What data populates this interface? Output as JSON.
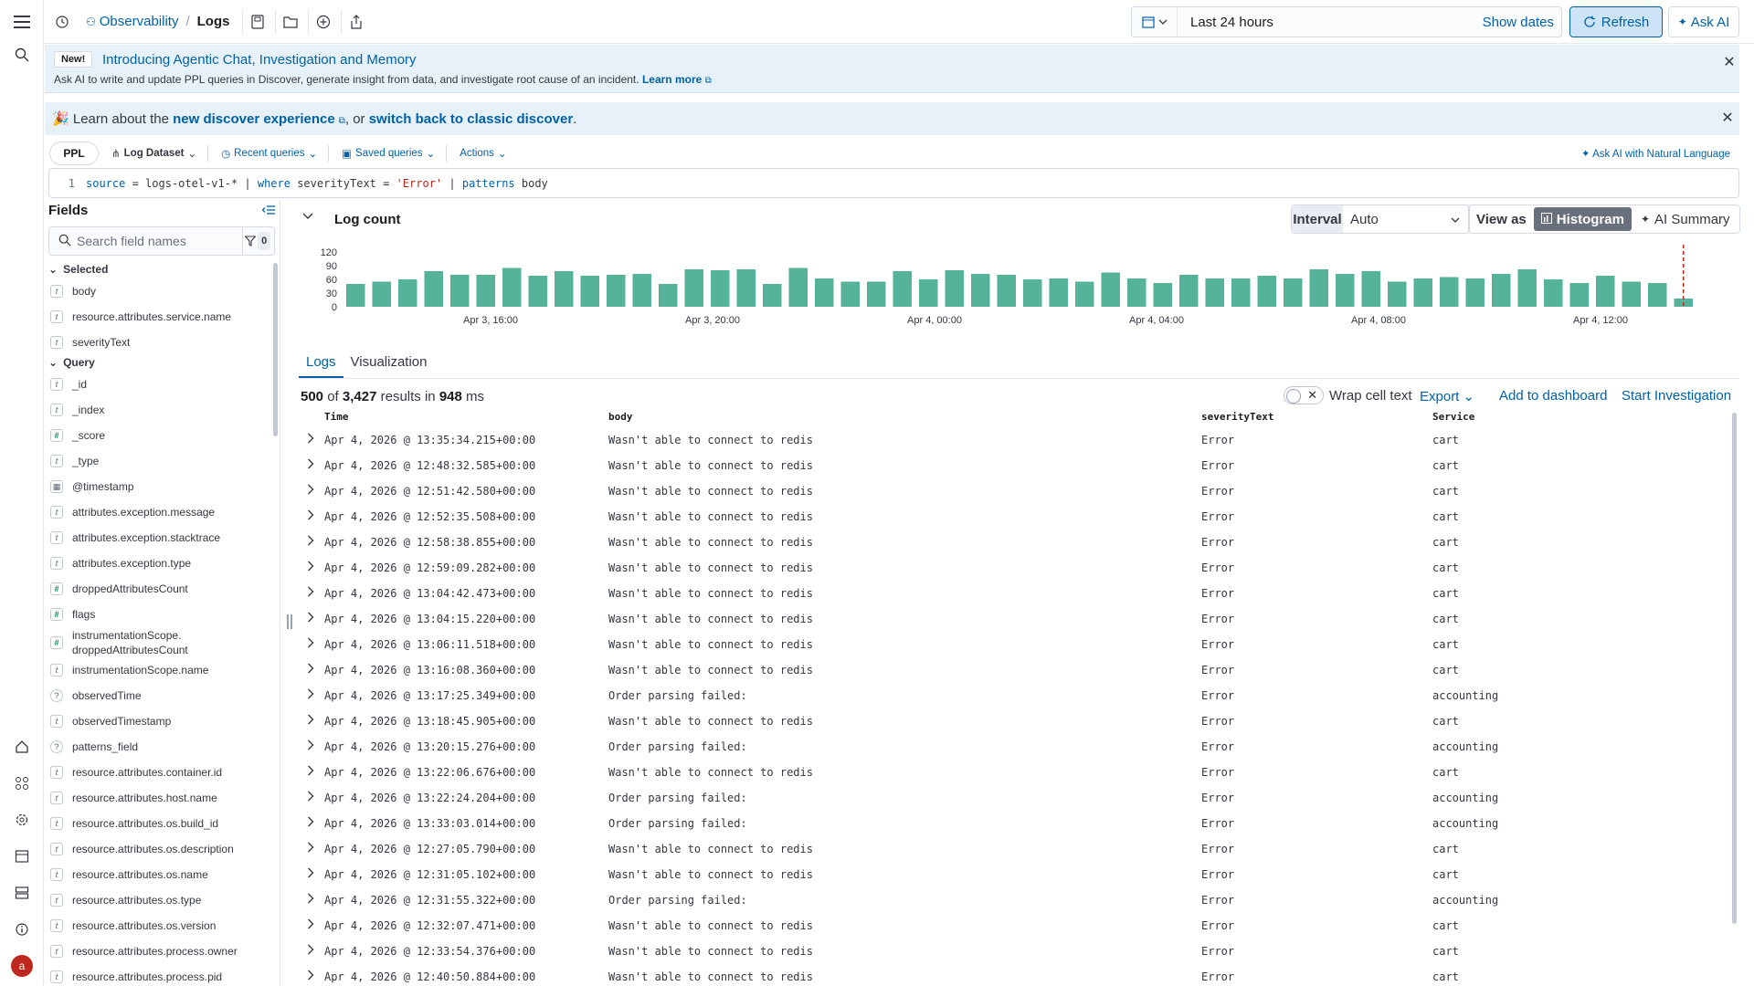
{
  "header": {
    "breadcrumb_root": "Observability",
    "breadcrumb_current": "Logs",
    "date_range": "Last 24 hours",
    "show_dates": "Show dates",
    "refresh": "Refresh",
    "ask_ai": "Ask AI"
  },
  "banner1": {
    "badge": "New!",
    "title": "Introducing Agentic Chat, Investigation and Memory",
    "body": "Ask AI to write and update PPL queries in Discover, generate insight from data, and investigate root cause of an incident.",
    "learn_more": "Learn more"
  },
  "banner2": {
    "emoji": "🎉",
    "prefix": "Learn about the",
    "link1": "new discover experience",
    "middle": ", or",
    "link2": "switch back to classic discover",
    "suffix": "."
  },
  "querybar": {
    "language": "PPL",
    "dataset": "Log Dataset",
    "recent": "Recent queries",
    "saved": "Saved queries",
    "actions": "Actions",
    "ask_ai_nl": "Ask AI with Natural Language",
    "line_no": "1",
    "query": {
      "p1": "source",
      "p2": " = logs-otel-v1-* | ",
      "p3": "where",
      "p4": " severityText = ",
      "p5": "'Error'",
      "p6": " | ",
      "p7": "patterns",
      "p8": " body"
    }
  },
  "fields": {
    "title": "Fields",
    "search_placeholder": "Search field names",
    "filter_count": "0",
    "selected_label": "Selected",
    "query_label": "Query",
    "selected": [
      {
        "type": "t",
        "name": "body"
      },
      {
        "type": "t",
        "name": "resource.attributes.service.name"
      },
      {
        "type": "t",
        "name": "severityText"
      }
    ],
    "query": [
      {
        "type": "t",
        "name": "_id"
      },
      {
        "type": "t",
        "name": "_index"
      },
      {
        "type": "#",
        "name": "_score"
      },
      {
        "type": "t",
        "name": "_type"
      },
      {
        "type": "date",
        "name": "@timestamp"
      },
      {
        "type": "t",
        "name": "attributes.exception.message"
      },
      {
        "type": "t",
        "name": "attributes.exception.stacktrace"
      },
      {
        "type": "t",
        "name": "attributes.exception.type"
      },
      {
        "type": "#",
        "name": "droppedAttributesCount"
      },
      {
        "type": "#",
        "name": "flags"
      },
      {
        "type": "#",
        "name": "instrumentationScope.",
        "name2": "droppedAttributesCount"
      },
      {
        "type": "t",
        "name": "instrumentationScope.name"
      },
      {
        "type": "?",
        "name": "observedTime"
      },
      {
        "type": "t",
        "name": "observedTimestamp"
      },
      {
        "type": "?",
        "name": "patterns_field"
      },
      {
        "type": "t",
        "name": "resource.attributes.container.id"
      },
      {
        "type": "t",
        "name": "resource.attributes.host.name"
      },
      {
        "type": "t",
        "name": "resource.attributes.os.build_id"
      },
      {
        "type": "t",
        "name": "resource.attributes.os.description"
      },
      {
        "type": "t",
        "name": "resource.attributes.os.name"
      },
      {
        "type": "t",
        "name": "resource.attributes.os.type"
      },
      {
        "type": "t",
        "name": "resource.attributes.os.version"
      },
      {
        "type": "t",
        "name": "resource.attributes.process.owner"
      },
      {
        "type": "t",
        "name": "resource.attributes.process.pid"
      }
    ]
  },
  "chart_header": {
    "title": "Log count",
    "interval_label": "Interval",
    "interval_value": "Auto",
    "view_as": "View as",
    "histogram": "Histogram",
    "ai_summary": "AI Summary"
  },
  "chart_data": {
    "type": "bar",
    "color": "#54b399",
    "y_ticks": [
      "120",
      "90",
      "60",
      "30",
      "0"
    ],
    "ylim": [
      0,
      120
    ],
    "x_ticks": [
      "Apr 3, 16:00",
      "Apr 3, 20:00",
      "Apr 4, 00:00",
      "Apr 4, 04:00",
      "Apr 4, 08:00",
      "Apr 4, 12:00"
    ],
    "values": [
      50,
      55,
      60,
      78,
      70,
      70,
      85,
      68,
      78,
      68,
      70,
      72,
      50,
      82,
      80,
      82,
      50,
      85,
      62,
      55,
      55,
      78,
      60,
      80,
      72,
      70,
      60,
      62,
      55,
      75,
      62,
      52,
      70,
      62,
      62,
      68,
      62,
      82,
      72,
      78,
      55,
      62,
      65,
      62,
      72,
      82,
      60,
      52,
      68,
      55,
      52,
      18
    ]
  },
  "tabs": {
    "logs": "Logs",
    "visualization": "Visualization"
  },
  "results": {
    "shown": "500",
    "of": "of",
    "total": "3,427",
    "in": "results in",
    "time": "948",
    "ms": "ms",
    "wrap": "Wrap cell text",
    "export": "Export",
    "add_dashboard": "Add to dashboard",
    "start_investigation": "Start Investigation"
  },
  "table": {
    "columns": [
      "Time",
      "body",
      "severityText",
      "Service"
    ],
    "rows": [
      [
        "Apr 4, 2026 @ 13:35:34.215+00:00",
        "Wasn't able to connect to redis",
        "Error",
        "cart"
      ],
      [
        "Apr 4, 2026 @ 12:48:32.585+00:00",
        "Wasn't able to connect to redis",
        "Error",
        "cart"
      ],
      [
        "Apr 4, 2026 @ 12:51:42.580+00:00",
        "Wasn't able to connect to redis",
        "Error",
        "cart"
      ],
      [
        "Apr 4, 2026 @ 12:52:35.508+00:00",
        "Wasn't able to connect to redis",
        "Error",
        "cart"
      ],
      [
        "Apr 4, 2026 @ 12:58:38.855+00:00",
        "Wasn't able to connect to redis",
        "Error",
        "cart"
      ],
      [
        "Apr 4, 2026 @ 12:59:09.282+00:00",
        "Wasn't able to connect to redis",
        "Error",
        "cart"
      ],
      [
        "Apr 4, 2026 @ 13:04:42.473+00:00",
        "Wasn't able to connect to redis",
        "Error",
        "cart"
      ],
      [
        "Apr 4, 2026 @ 13:04:15.220+00:00",
        "Wasn't able to connect to redis",
        "Error",
        "cart"
      ],
      [
        "Apr 4, 2026 @ 13:06:11.518+00:00",
        "Wasn't able to connect to redis",
        "Error",
        "cart"
      ],
      [
        "Apr 4, 2026 @ 13:16:08.360+00:00",
        "Wasn't able to connect to redis",
        "Error",
        "cart"
      ],
      [
        "Apr 4, 2026 @ 13:17:25.349+00:00",
        "Order parsing failed:",
        "Error",
        "accounting"
      ],
      [
        "Apr 4, 2026 @ 13:18:45.905+00:00",
        "Wasn't able to connect to redis",
        "Error",
        "cart"
      ],
      [
        "Apr 4, 2026 @ 13:20:15.276+00:00",
        "Order parsing failed:",
        "Error",
        "accounting"
      ],
      [
        "Apr 4, 2026 @ 13:22:06.676+00:00",
        "Wasn't able to connect to redis",
        "Error",
        "cart"
      ],
      [
        "Apr 4, 2026 @ 13:22:24.204+00:00",
        "Order parsing failed:",
        "Error",
        "accounting"
      ],
      [
        "Apr 4, 2026 @ 13:33:03.014+00:00",
        "Order parsing failed:",
        "Error",
        "accounting"
      ],
      [
        "Apr 4, 2026 @ 12:27:05.790+00:00",
        "Wasn't able to connect to redis",
        "Error",
        "cart"
      ],
      [
        "Apr 4, 2026 @ 12:31:05.102+00:00",
        "Wasn't able to connect to redis",
        "Error",
        "cart"
      ],
      [
        "Apr 4, 2026 @ 12:31:55.322+00:00",
        "Order parsing failed:",
        "Error",
        "accounting"
      ],
      [
        "Apr 4, 2026 @ 12:32:07.471+00:00",
        "Wasn't able to connect to redis",
        "Error",
        "cart"
      ],
      [
        "Apr 4, 2026 @ 12:33:54.376+00:00",
        "Wasn't able to connect to redis",
        "Error",
        "cart"
      ],
      [
        "Apr 4, 2026 @ 12:40:50.884+00:00",
        "Wasn't able to connect to redis",
        "Error",
        "cart"
      ]
    ]
  }
}
